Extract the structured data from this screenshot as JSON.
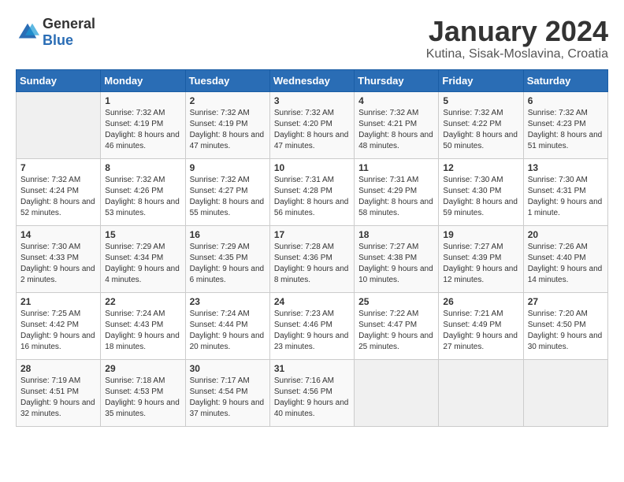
{
  "logo": {
    "general": "General",
    "blue": "Blue"
  },
  "title": "January 2024",
  "location": "Kutina, Sisak-Moslavina, Croatia",
  "days_of_week": [
    "Sunday",
    "Monday",
    "Tuesday",
    "Wednesday",
    "Thursday",
    "Friday",
    "Saturday"
  ],
  "weeks": [
    [
      {
        "day": "",
        "sunrise": "",
        "sunset": "",
        "daylight": ""
      },
      {
        "day": "1",
        "sunrise": "Sunrise: 7:32 AM",
        "sunset": "Sunset: 4:19 PM",
        "daylight": "Daylight: 8 hours and 46 minutes."
      },
      {
        "day": "2",
        "sunrise": "Sunrise: 7:32 AM",
        "sunset": "Sunset: 4:19 PM",
        "daylight": "Daylight: 8 hours and 47 minutes."
      },
      {
        "day": "3",
        "sunrise": "Sunrise: 7:32 AM",
        "sunset": "Sunset: 4:20 PM",
        "daylight": "Daylight: 8 hours and 47 minutes."
      },
      {
        "day": "4",
        "sunrise": "Sunrise: 7:32 AM",
        "sunset": "Sunset: 4:21 PM",
        "daylight": "Daylight: 8 hours and 48 minutes."
      },
      {
        "day": "5",
        "sunrise": "Sunrise: 7:32 AM",
        "sunset": "Sunset: 4:22 PM",
        "daylight": "Daylight: 8 hours and 50 minutes."
      },
      {
        "day": "6",
        "sunrise": "Sunrise: 7:32 AM",
        "sunset": "Sunset: 4:23 PM",
        "daylight": "Daylight: 8 hours and 51 minutes."
      }
    ],
    [
      {
        "day": "7",
        "sunrise": "Sunrise: 7:32 AM",
        "sunset": "Sunset: 4:24 PM",
        "daylight": "Daylight: 8 hours and 52 minutes."
      },
      {
        "day": "8",
        "sunrise": "Sunrise: 7:32 AM",
        "sunset": "Sunset: 4:26 PM",
        "daylight": "Daylight: 8 hours and 53 minutes."
      },
      {
        "day": "9",
        "sunrise": "Sunrise: 7:32 AM",
        "sunset": "Sunset: 4:27 PM",
        "daylight": "Daylight: 8 hours and 55 minutes."
      },
      {
        "day": "10",
        "sunrise": "Sunrise: 7:31 AM",
        "sunset": "Sunset: 4:28 PM",
        "daylight": "Daylight: 8 hours and 56 minutes."
      },
      {
        "day": "11",
        "sunrise": "Sunrise: 7:31 AM",
        "sunset": "Sunset: 4:29 PM",
        "daylight": "Daylight: 8 hours and 58 minutes."
      },
      {
        "day": "12",
        "sunrise": "Sunrise: 7:30 AM",
        "sunset": "Sunset: 4:30 PM",
        "daylight": "Daylight: 8 hours and 59 minutes."
      },
      {
        "day": "13",
        "sunrise": "Sunrise: 7:30 AM",
        "sunset": "Sunset: 4:31 PM",
        "daylight": "Daylight: 9 hours and 1 minute."
      }
    ],
    [
      {
        "day": "14",
        "sunrise": "Sunrise: 7:30 AM",
        "sunset": "Sunset: 4:33 PM",
        "daylight": "Daylight: 9 hours and 2 minutes."
      },
      {
        "day": "15",
        "sunrise": "Sunrise: 7:29 AM",
        "sunset": "Sunset: 4:34 PM",
        "daylight": "Daylight: 9 hours and 4 minutes."
      },
      {
        "day": "16",
        "sunrise": "Sunrise: 7:29 AM",
        "sunset": "Sunset: 4:35 PM",
        "daylight": "Daylight: 9 hours and 6 minutes."
      },
      {
        "day": "17",
        "sunrise": "Sunrise: 7:28 AM",
        "sunset": "Sunset: 4:36 PM",
        "daylight": "Daylight: 9 hours and 8 minutes."
      },
      {
        "day": "18",
        "sunrise": "Sunrise: 7:27 AM",
        "sunset": "Sunset: 4:38 PM",
        "daylight": "Daylight: 9 hours and 10 minutes."
      },
      {
        "day": "19",
        "sunrise": "Sunrise: 7:27 AM",
        "sunset": "Sunset: 4:39 PM",
        "daylight": "Daylight: 9 hours and 12 minutes."
      },
      {
        "day": "20",
        "sunrise": "Sunrise: 7:26 AM",
        "sunset": "Sunset: 4:40 PM",
        "daylight": "Daylight: 9 hours and 14 minutes."
      }
    ],
    [
      {
        "day": "21",
        "sunrise": "Sunrise: 7:25 AM",
        "sunset": "Sunset: 4:42 PM",
        "daylight": "Daylight: 9 hours and 16 minutes."
      },
      {
        "day": "22",
        "sunrise": "Sunrise: 7:24 AM",
        "sunset": "Sunset: 4:43 PM",
        "daylight": "Daylight: 9 hours and 18 minutes."
      },
      {
        "day": "23",
        "sunrise": "Sunrise: 7:24 AM",
        "sunset": "Sunset: 4:44 PM",
        "daylight": "Daylight: 9 hours and 20 minutes."
      },
      {
        "day": "24",
        "sunrise": "Sunrise: 7:23 AM",
        "sunset": "Sunset: 4:46 PM",
        "daylight": "Daylight: 9 hours and 23 minutes."
      },
      {
        "day": "25",
        "sunrise": "Sunrise: 7:22 AM",
        "sunset": "Sunset: 4:47 PM",
        "daylight": "Daylight: 9 hours and 25 minutes."
      },
      {
        "day": "26",
        "sunrise": "Sunrise: 7:21 AM",
        "sunset": "Sunset: 4:49 PM",
        "daylight": "Daylight: 9 hours and 27 minutes."
      },
      {
        "day": "27",
        "sunrise": "Sunrise: 7:20 AM",
        "sunset": "Sunset: 4:50 PM",
        "daylight": "Daylight: 9 hours and 30 minutes."
      }
    ],
    [
      {
        "day": "28",
        "sunrise": "Sunrise: 7:19 AM",
        "sunset": "Sunset: 4:51 PM",
        "daylight": "Daylight: 9 hours and 32 minutes."
      },
      {
        "day": "29",
        "sunrise": "Sunrise: 7:18 AM",
        "sunset": "Sunset: 4:53 PM",
        "daylight": "Daylight: 9 hours and 35 minutes."
      },
      {
        "day": "30",
        "sunrise": "Sunrise: 7:17 AM",
        "sunset": "Sunset: 4:54 PM",
        "daylight": "Daylight: 9 hours and 37 minutes."
      },
      {
        "day": "31",
        "sunrise": "Sunrise: 7:16 AM",
        "sunset": "Sunset: 4:56 PM",
        "daylight": "Daylight: 9 hours and 40 minutes."
      },
      {
        "day": "",
        "sunrise": "",
        "sunset": "",
        "daylight": ""
      },
      {
        "day": "",
        "sunrise": "",
        "sunset": "",
        "daylight": ""
      },
      {
        "day": "",
        "sunrise": "",
        "sunset": "",
        "daylight": ""
      }
    ]
  ]
}
